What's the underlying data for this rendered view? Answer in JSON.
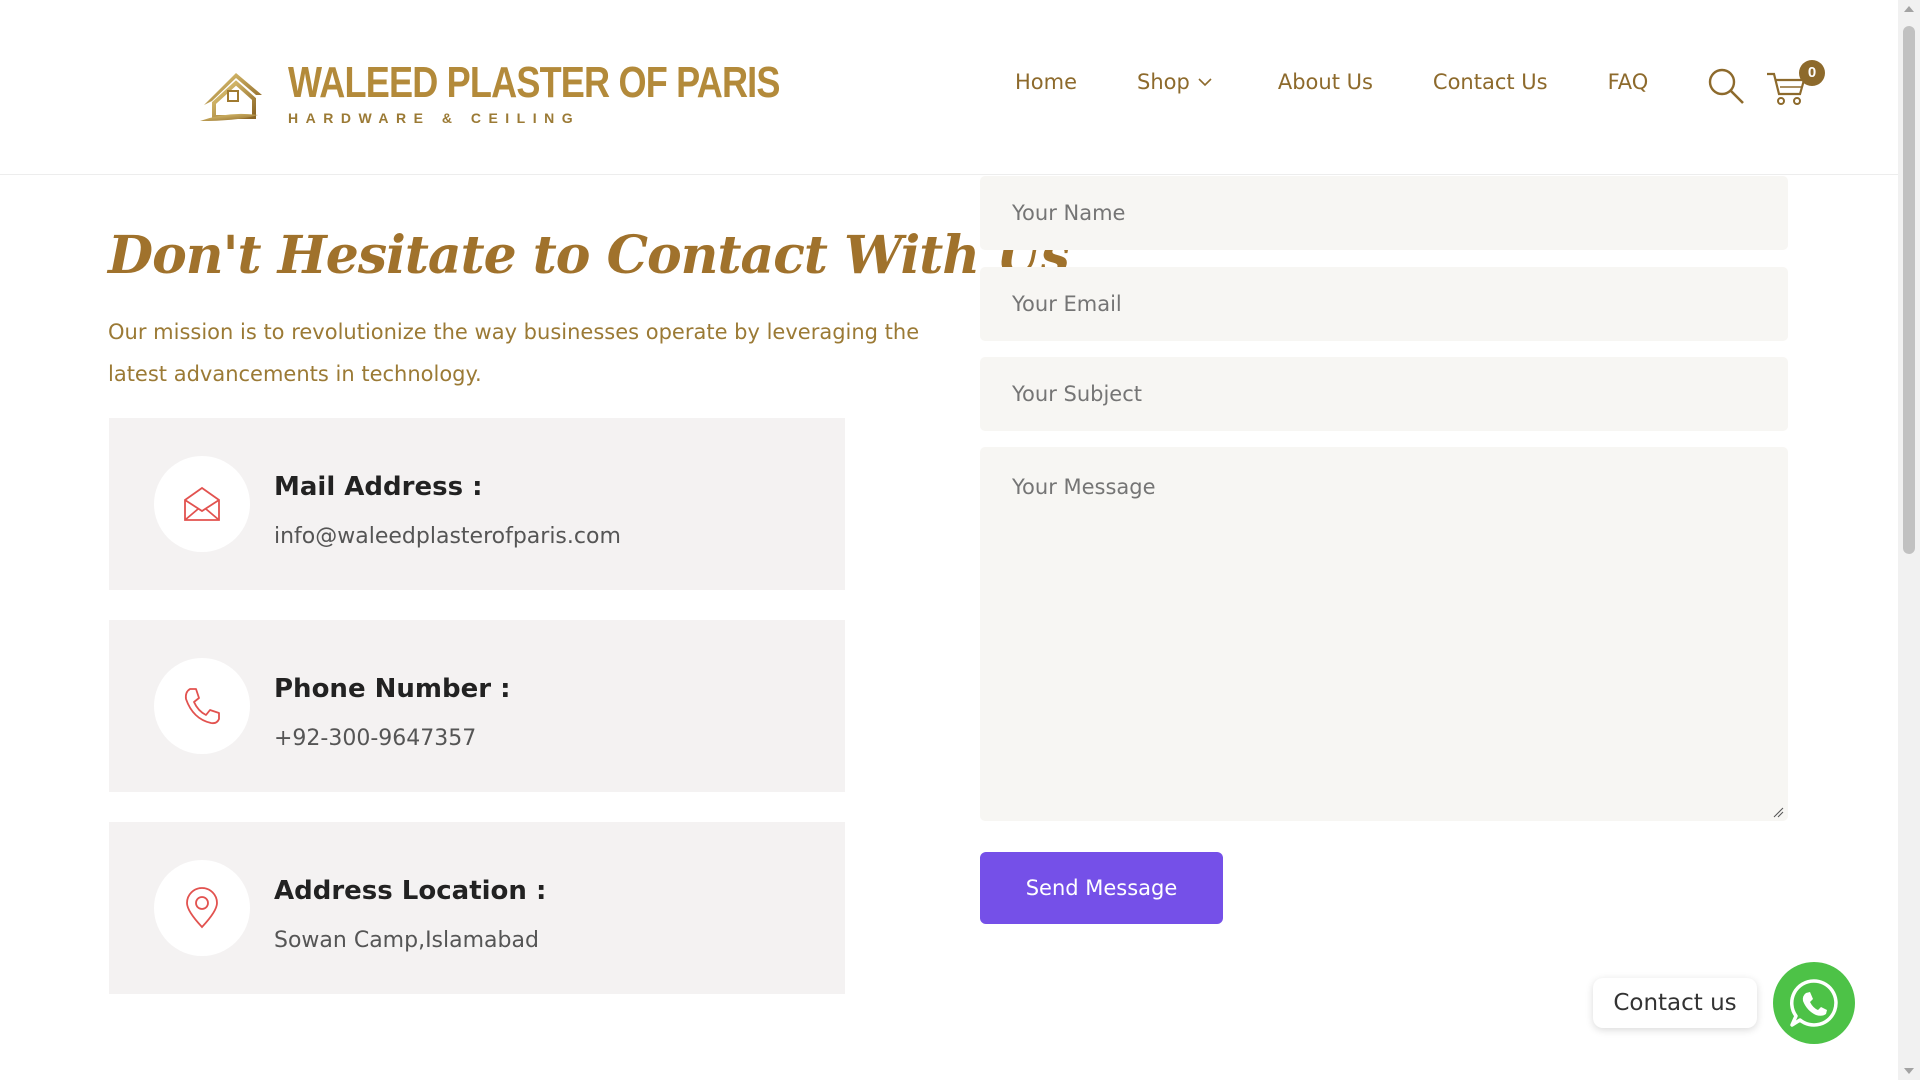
{
  "header": {
    "logo": {
      "name": "WALEED PLASTER OF PARIS",
      "tagline": "HARDWARE & CEILING"
    },
    "nav": [
      {
        "label": "Home"
      },
      {
        "label": "Shop"
      },
      {
        "label": "About Us"
      },
      {
        "label": "Contact Us"
      },
      {
        "label": "FAQ"
      }
    ],
    "cart_count": "0",
    "icons": [
      "search-icon",
      "cart-icon",
      "chevron-down-icon"
    ]
  },
  "contact": {
    "heading": "Don't Hesitate to Contact With Us",
    "intro": "Our mission is to revolutionize the way businesses operate by leveraging the latest advancements in technology.",
    "cards": [
      {
        "title": "Mail Address :",
        "value": "info@waleedplasterofparis.com",
        "icon": "envelope-icon"
      },
      {
        "title": "Phone Number :",
        "value": "+92-300-9647357",
        "icon": "phone-icon"
      },
      {
        "title": "Address Location :",
        "value": "Sowan Camp,Islamabad",
        "icon": "location-pin-icon"
      }
    ]
  },
  "form": {
    "name_placeholder": "Your Name",
    "email_placeholder": "Your Email",
    "subject_placeholder": "Your Subject",
    "message_placeholder": "Your Message",
    "submit_label": "Send Message"
  },
  "whatsapp": {
    "label": "Contact us",
    "icon": "whatsapp-icon"
  },
  "colors": {
    "brand_gold": "#a0722c",
    "accent_purple": "#7550e8",
    "whatsapp_green": "#4dc247"
  }
}
